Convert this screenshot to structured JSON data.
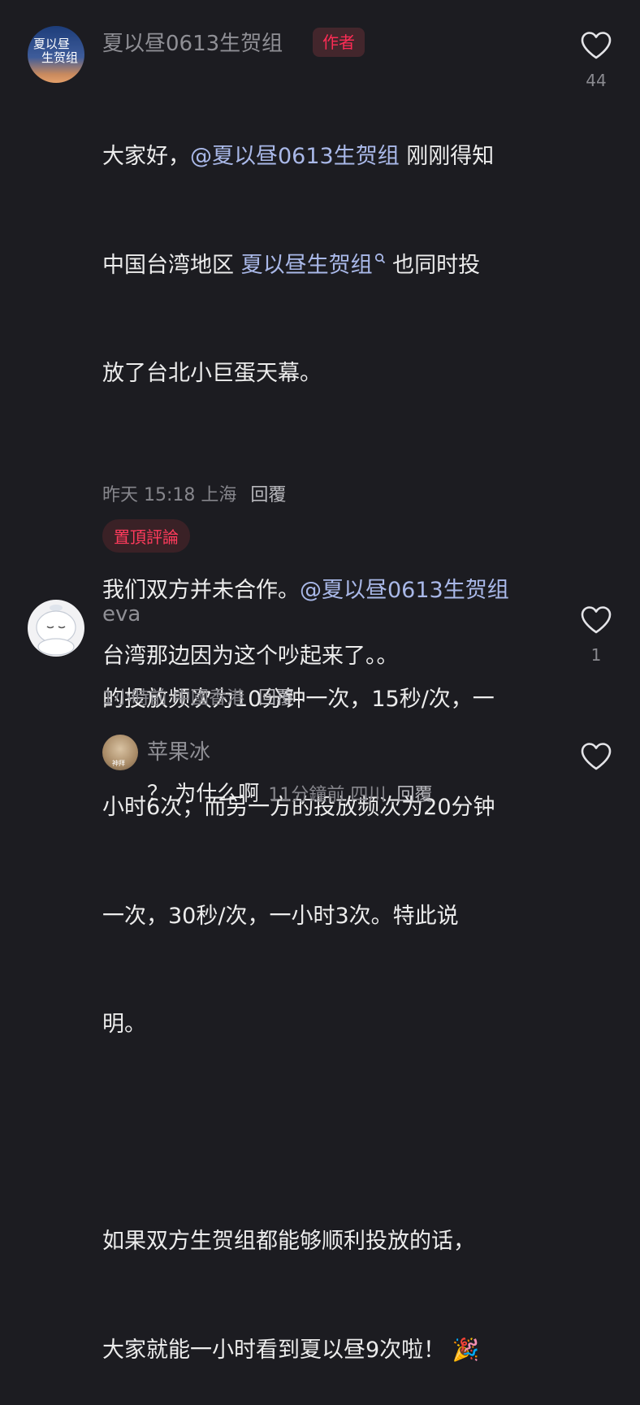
{
  "comment1": {
    "name": "夏以昼0613生贺组",
    "badge": "作者",
    "line1_a": "大家好，",
    "line1_mention": "@夏以昼0613生贺组",
    "line1_b": " 刚刚得知",
    "line2_a": "中国台湾地区 ",
    "line2_link": "夏以昼生贺组",
    "line2_b": " 也同时投",
    "line3": "放了台北小巨蛋天幕。",
    "line4_a": "我们双方并未合作。",
    "line4_mention": "@夏以昼0613生贺组",
    "line5": "的投放频次为10分钟一次，15秒/次，一",
    "line6": "小时6次；而另一方的投放频次为20分钟",
    "line7": "一次，30秒/次，一小时3次。特此说",
    "line8": "明。",
    "line9": "如果双方生贺组都能够顺利投放的话，",
    "line10": "大家就能一小时看到夏以昼9次啦！",
    "emoji": "🎉",
    "meta": "昨天 15:18 上海",
    "reply": "回覆",
    "pin": "置頂評論",
    "likes": "44",
    "avatar_text_1": "夏以昼",
    "avatar_text_2": "生贺组"
  },
  "comment2": {
    "name": "eva",
    "text": "台湾那边因为这个吵起来了。。",
    "meta": "1小時前 中國香港",
    "reply": "回覆",
    "likes": "1"
  },
  "comment3": {
    "name": "苹果冰",
    "text": "？ 为什么啊",
    "meta": "11分鐘前 四川",
    "reply": "回覆",
    "avatar_label": "神拜"
  },
  "colors": {
    "accent": "#fe2c55",
    "mention": "#a9b8e8",
    "background": "#1c1c21"
  }
}
